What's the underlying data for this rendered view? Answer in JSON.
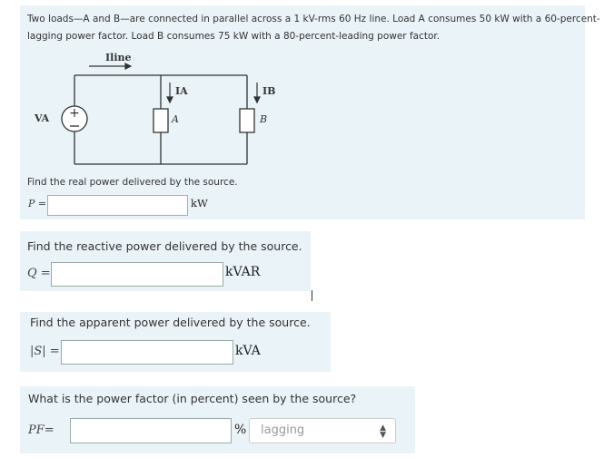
{
  "problem": {
    "line1": "Two loads—A and B—are connected in parallel across a 1 kV-rms 60 Hz line. Load A consumes 50 kW with a 60-percent-",
    "line2": "lagging power factor. Load B consumes 75 kW with a 80-percent-leading power factor."
  },
  "circuit": {
    "i_line": "Iline",
    "ia": "IA",
    "ib": "IB",
    "va": "VA",
    "load_a": "A",
    "load_b": "B"
  },
  "q1": {
    "prompt": "Find the real power delivered by the source.",
    "label": "P =",
    "value": "",
    "unit": "kW"
  },
  "q2": {
    "prompt": "Find the reactive power delivered by the source.",
    "label": "Q =",
    "value": "",
    "unit": "kVAR"
  },
  "q3": {
    "prompt": "Find the apparent power delivered by the source.",
    "label": "|S| =",
    "value": "",
    "unit": "kVA"
  },
  "q4": {
    "prompt": "What is the power factor (in percent) seen by the source?",
    "label": "PF=",
    "value": "",
    "unit": "%",
    "select_value": "lagging"
  }
}
